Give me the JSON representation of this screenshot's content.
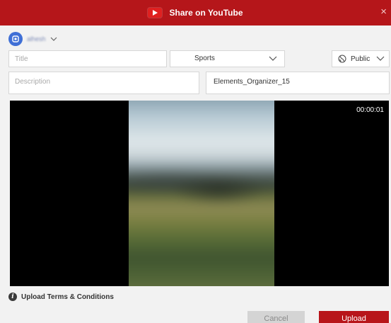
{
  "window": {
    "title": "Share on YouTube",
    "close_glyph": "×"
  },
  "account": {
    "name": "alhesh"
  },
  "form": {
    "title_placeholder": "Title",
    "category_value": "Sports",
    "privacy_value": "Public",
    "description_placeholder": "Description",
    "filename_value": "Elements_Organizer_15"
  },
  "preview": {
    "timecode": "00:00:01"
  },
  "footer": {
    "terms_label": "Upload Terms & Conditions",
    "info_glyph": "i",
    "cancel_label": "Cancel",
    "upload_label": "Upload"
  },
  "colors": {
    "titlebar": "#b5161a",
    "upload_button": "#b8151a",
    "cancel_button": "#d4d4d4",
    "background": "#f2f2f2"
  },
  "icons": {
    "logo": "youtube-play-icon",
    "account": "user-avatar-icon",
    "dropdown": "chevron-down-icon",
    "privacy": "globe-icon",
    "terms": "info-icon",
    "close": "close-icon"
  }
}
